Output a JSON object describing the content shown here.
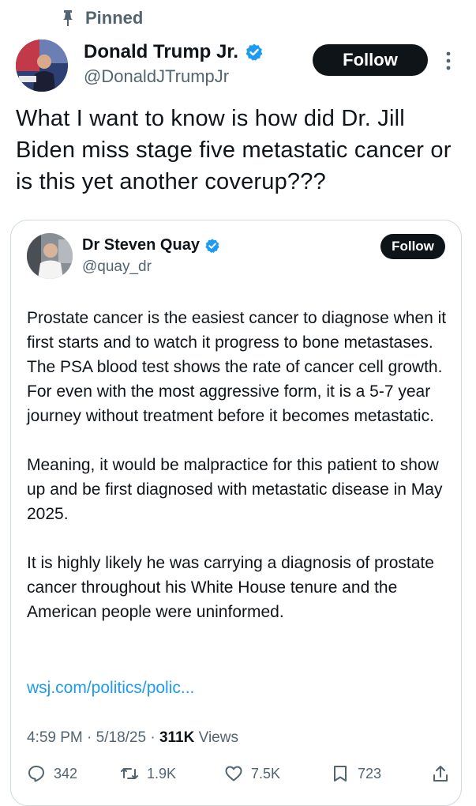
{
  "pinned_label": "Pinned",
  "author": {
    "name": "Donald Trump Jr.",
    "handle": "@DonaldJTrumpJr",
    "follow_label": "Follow"
  },
  "tweet_text": "What I want to know is how did Dr. Jill Biden miss stage five metastatic cancer or is this yet another coverup???",
  "quote": {
    "name": "Dr Steven Quay",
    "handle": "@quay_dr",
    "follow_label": "Follow",
    "paragraphs": [
      "Prostate cancer is the easiest cancer to diagnose when it first starts and to watch it progress to bone metastases. The PSA blood test shows the rate of cancer cell growth. For even with the most aggressive form, it is a 5-7 year journey without treatment before it becomes metastatic.",
      "Meaning, it would be malpractice for this patient to show up and be first diagnosed with metastatic disease in May 2025.",
      "It is highly likely he was carrying a diagnosis of prostate cancer throughout his White House tenure and the American people were uninformed."
    ],
    "link": "wsj.com/politics/polic...",
    "time": "4:59 PM",
    "date": "5/18/25",
    "views_count": "311K",
    "views_label": "Views"
  },
  "actions": {
    "replies": "342",
    "reposts": "1.9K",
    "likes": "7.5K",
    "bookmarks": "723"
  },
  "colors": {
    "verified": "#1d9bf0",
    "link": "#1d9bf0",
    "secondary_text": "#536471"
  }
}
